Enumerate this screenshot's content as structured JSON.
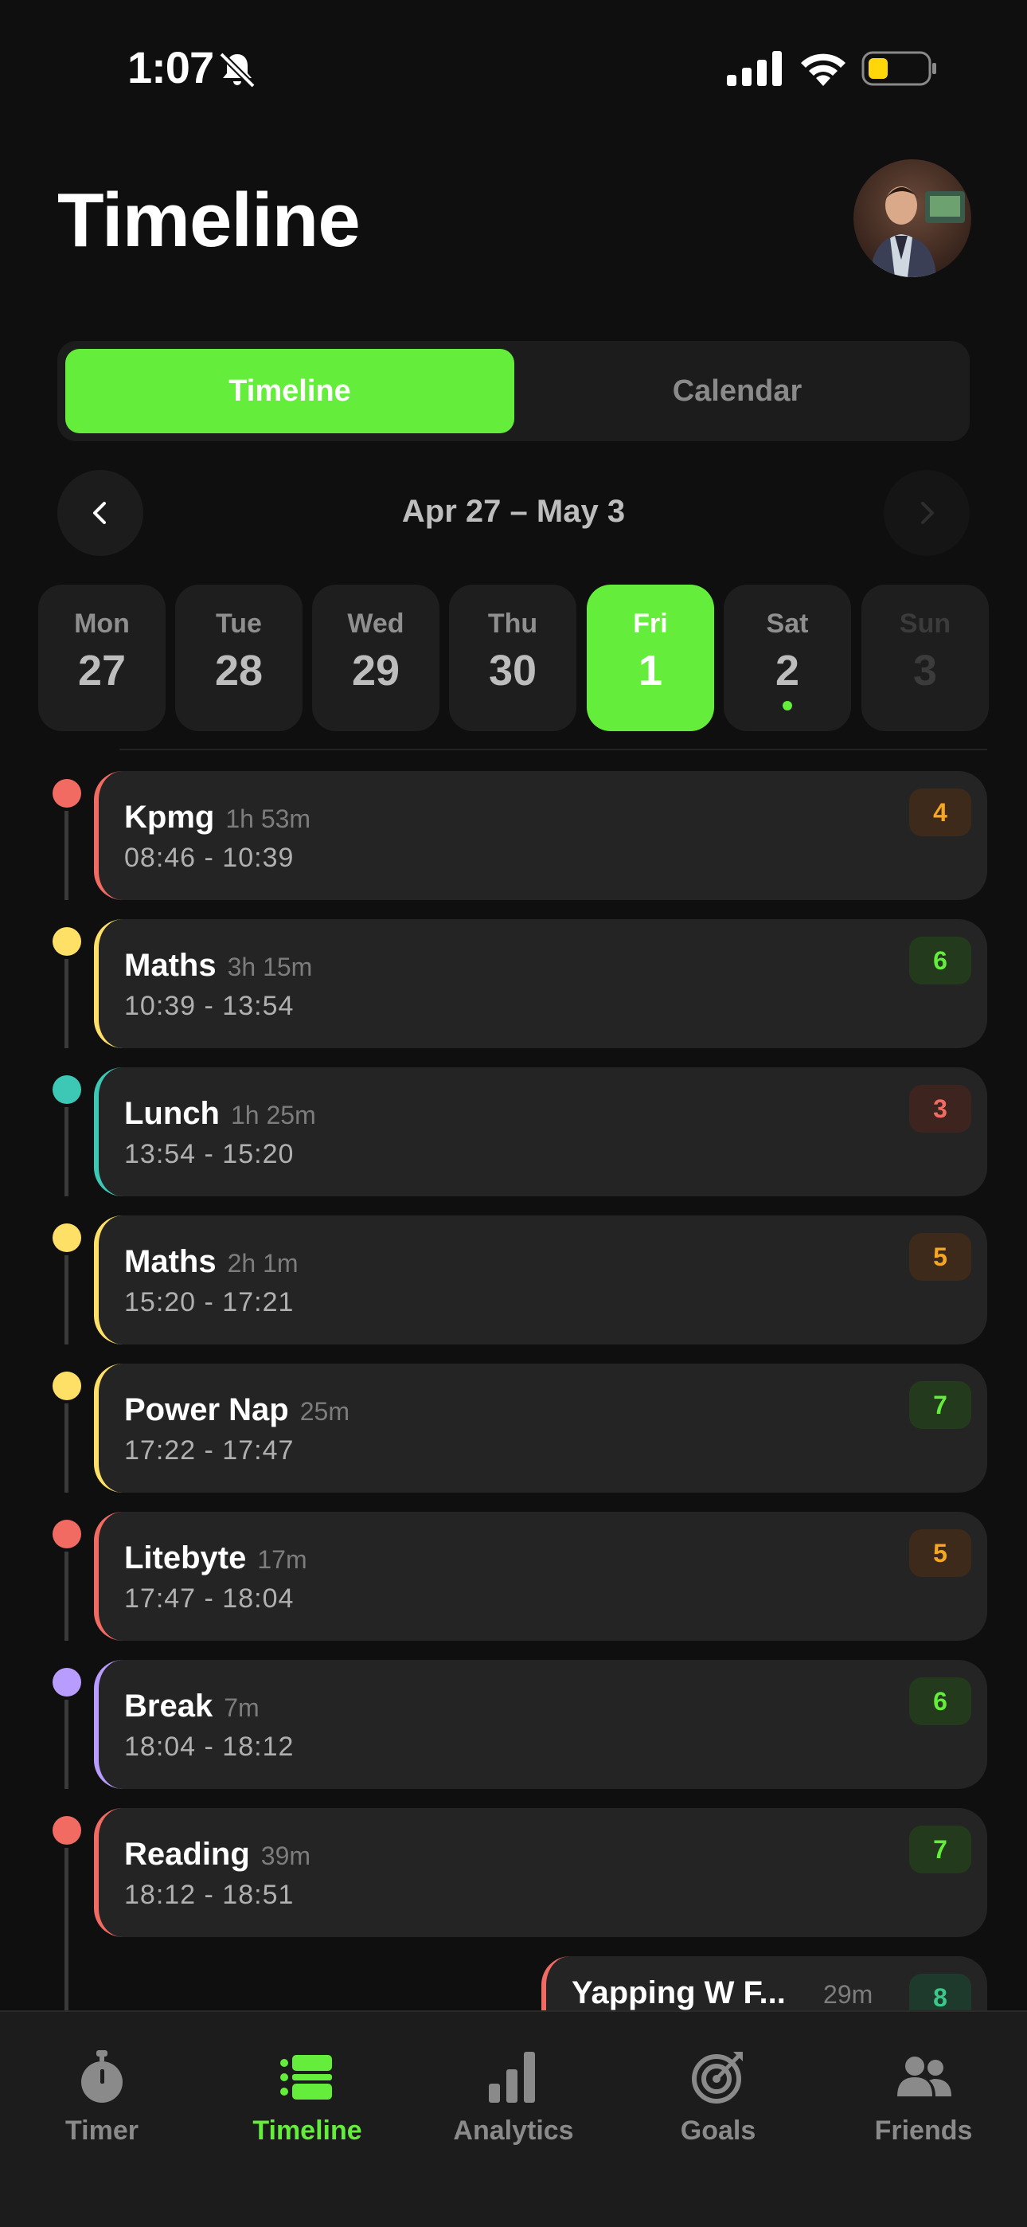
{
  "status_bar": {
    "time": "1:07"
  },
  "header": {
    "title": "Timeline"
  },
  "segmented": {
    "timeline_label": "Timeline",
    "calendar_label": "Calendar"
  },
  "date_nav": {
    "range": "Apr 27 – May 3"
  },
  "days": [
    {
      "name": "Mon",
      "num": "27"
    },
    {
      "name": "Tue",
      "num": "28"
    },
    {
      "name": "Wed",
      "num": "29"
    },
    {
      "name": "Thu",
      "num": "30"
    },
    {
      "name": "Fri",
      "num": "1",
      "selected": true
    },
    {
      "name": "Sat",
      "num": "2",
      "has_dot": true
    },
    {
      "name": "Sun",
      "num": "3",
      "future": true
    }
  ],
  "entries": [
    {
      "title": "Kpmg",
      "duration": "1h 53m",
      "range": "08:46 - 10:39",
      "badge": "4",
      "color": "#f26b63",
      "badge_color": "#f5a623",
      "badge_bg": "#3d2a1a"
    },
    {
      "title": "Maths",
      "duration": "3h 15m",
      "range": "10:39 - 13:54",
      "badge": "6",
      "color": "#ffe066",
      "badge_color": "#64ee3b",
      "badge_bg": "#243a1c"
    },
    {
      "title": "Lunch",
      "duration": "1h 25m",
      "range": "13:54 - 15:20",
      "badge": "3",
      "color": "#3cc8b4",
      "badge_color": "#f26b63",
      "badge_bg": "#3d241f"
    },
    {
      "title": "Maths",
      "duration": "2h 1m",
      "range": "15:20 - 17:21",
      "badge": "5",
      "color": "#ffe066",
      "badge_color": "#f5a623",
      "badge_bg": "#3d2a1a"
    },
    {
      "title": "Power Nap",
      "duration": "25m",
      "range": "17:22 - 17:47",
      "badge": "7",
      "color": "#ffe066",
      "badge_color": "#64ee3b",
      "badge_bg": "#243a1c"
    },
    {
      "title": "Litebyte",
      "duration": "17m",
      "range": "17:47 - 18:04",
      "badge": "5",
      "color": "#f26b63",
      "badge_color": "#f5a623",
      "badge_bg": "#3d2a1a"
    },
    {
      "title": "Break",
      "duration": "7m",
      "range": "18:04 - 18:12",
      "badge": "6",
      "color": "#b99cff",
      "badge_color": "#64ee3b",
      "badge_bg": "#243a1c"
    },
    {
      "title": "Reading",
      "duration": "39m",
      "range": "18:12 - 18:51",
      "badge": "7",
      "color": "#f26b63",
      "badge_color": "#64ee3b",
      "badge_bg": "#243a1c"
    }
  ],
  "partial_entry": {
    "title": "Yapping W F...",
    "duration": "29m",
    "badge": "8",
    "color": "#f26b63",
    "badge_color": "#3cc88a",
    "badge_bg": "#1d3a2c"
  },
  "tabs": [
    {
      "label": "Timer",
      "icon": "stopwatch-icon"
    },
    {
      "label": "Timeline",
      "icon": "timeline-icon",
      "active": true
    },
    {
      "label": "Analytics",
      "icon": "bar-chart-icon"
    },
    {
      "label": "Goals",
      "icon": "target-icon"
    },
    {
      "label": "Friends",
      "icon": "people-icon"
    }
  ],
  "colors": {
    "accent": "#64ee3b",
    "background": "#0f0f0f",
    "card": "#242424"
  }
}
